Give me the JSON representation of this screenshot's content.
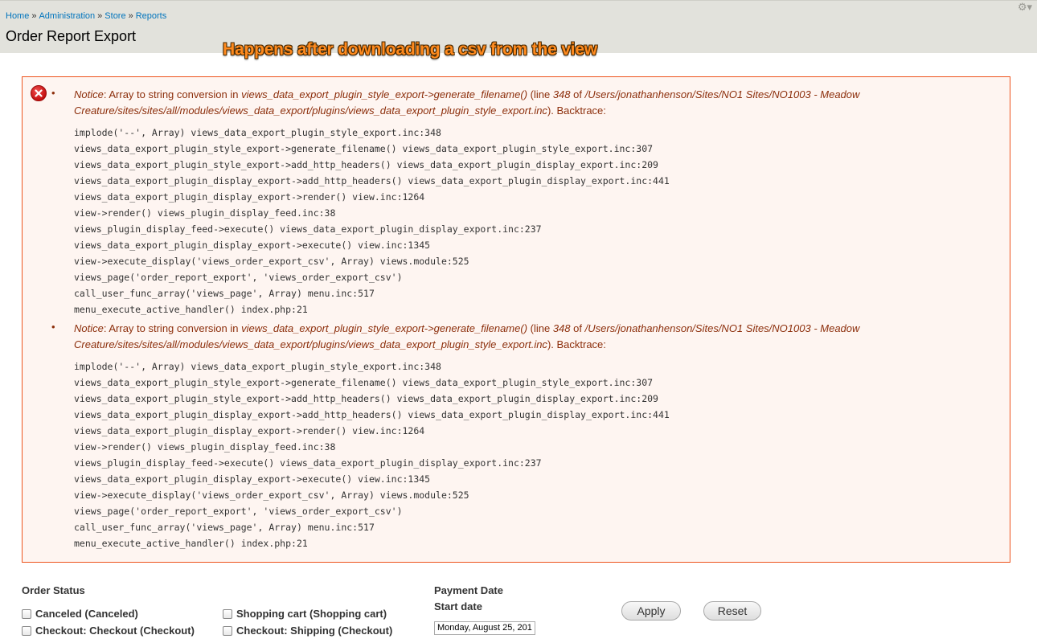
{
  "breadcrumb": {
    "home": "Home",
    "administration": "Administration",
    "store": "Store",
    "reports": "Reports",
    "separator": "»"
  },
  "page_title": "Order Report Export",
  "annotation": "Happens after downloading a csv from the view",
  "messages": [
    {
      "type": "Notice",
      "text_before": ": Array to string conversion in ",
      "function": "views_data_export_plugin_style_export->generate_filename()",
      "line_prefix": " (line ",
      "line_number": "348",
      "of_text": " of ",
      "path_line1": "/Users/jonathanhenson/Sites/NO1 Sites/NO1003 - Meadow",
      "path_line2": "Creature/sites/sites/all/modules/views_data_export/plugins/views_data_export_plugin_style_export.inc",
      "suffix": "). Backtrace:",
      "trace": [
        "implode('--', Array) views_data_export_plugin_style_export.inc:348",
        "views_data_export_plugin_style_export->generate_filename() views_data_export_plugin_style_export.inc:307",
        "views_data_export_plugin_style_export->add_http_headers() views_data_export_plugin_display_export.inc:209",
        "views_data_export_plugin_display_export->add_http_headers() views_data_export_plugin_display_export.inc:441",
        "views_data_export_plugin_display_export->render() view.inc:1264",
        "view->render() views_plugin_display_feed.inc:38",
        "views_plugin_display_feed->execute() views_data_export_plugin_display_export.inc:237",
        "views_data_export_plugin_display_export->execute() view.inc:1345",
        "view->execute_display('views_order_export_csv', Array) views.module:525",
        "views_page('order_report_export', 'views_order_export_csv')",
        "call_user_func_array('views_page', Array) menu.inc:517",
        "menu_execute_active_handler() index.php:21"
      ]
    },
    {
      "type": "Notice",
      "text_before": ": Array to string conversion in ",
      "function": "views_data_export_plugin_style_export->generate_filename()",
      "line_prefix": " (line ",
      "line_number": "348",
      "of_text": " of ",
      "path_line1": "/Users/jonathanhenson/Sites/NO1 Sites/NO1003 - Meadow",
      "path_line2": "Creature/sites/sites/all/modules/views_data_export/plugins/views_data_export_plugin_style_export.inc",
      "suffix": "). Backtrace:",
      "trace": [
        "implode('--', Array) views_data_export_plugin_style_export.inc:348",
        "views_data_export_plugin_style_export->generate_filename() views_data_export_plugin_style_export.inc:307",
        "views_data_export_plugin_style_export->add_http_headers() views_data_export_plugin_display_export.inc:209",
        "views_data_export_plugin_display_export->add_http_headers() views_data_export_plugin_display_export.inc:441",
        "views_data_export_plugin_display_export->render() view.inc:1264",
        "view->render() views_plugin_display_feed.inc:38",
        "views_plugin_display_feed->execute() views_data_export_plugin_display_export.inc:237",
        "views_data_export_plugin_display_export->execute() view.inc:1345",
        "view->execute_display('views_order_export_csv', Array) views.module:525",
        "views_page('order_report_export', 'views_order_export_csv')",
        "call_user_func_array('views_page', Array) menu.inc:517",
        "menu_execute_active_handler() index.php:21"
      ]
    }
  ],
  "filters": {
    "order_status_label": "Order Status",
    "checkboxes": {
      "canceled": "Canceled (Canceled)",
      "shopping_cart": "Shopping cart (Shopping cart)",
      "checkout_checkout": "Checkout: Checkout (Checkout)",
      "checkout_shipping": "Checkout: Shipping (Checkout)"
    },
    "payment_date_label": "Payment Date",
    "start_date_label": "Start date",
    "start_date_value": "Monday, August 25, 201",
    "apply_label": "Apply",
    "reset_label": "Reset"
  },
  "colors": {
    "link": "#0074bd",
    "error_bg": "#fef5f1",
    "error_border": "#ed541d",
    "error_text": "#8c2e0b",
    "annotation": "#ff8a1e",
    "header_bg": "#e2e2dc"
  }
}
